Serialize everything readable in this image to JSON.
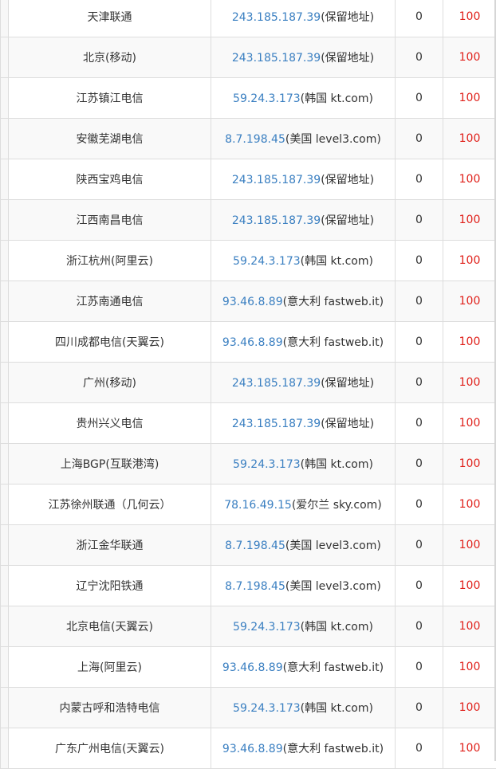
{
  "rows": [
    {
      "node": "天津联通",
      "ip": "243.185.187.39",
      "location": "(保留地址)",
      "loss": "0",
      "value": "100"
    },
    {
      "node": "北京(移动)",
      "ip": "243.185.187.39",
      "location": "(保留地址)",
      "loss": "0",
      "value": "100"
    },
    {
      "node": "江苏镇江电信",
      "ip": "59.24.3.173",
      "location": "(韩国 kt.com)",
      "loss": "0",
      "value": "100"
    },
    {
      "node": "安徽芜湖电信",
      "ip": "8.7.198.45",
      "location": "(美国 level3.com)",
      "loss": "0",
      "value": "100"
    },
    {
      "node": "陕西宝鸡电信",
      "ip": "243.185.187.39",
      "location": "(保留地址)",
      "loss": "0",
      "value": "100"
    },
    {
      "node": "江西南昌电信",
      "ip": "243.185.187.39",
      "location": "(保留地址)",
      "loss": "0",
      "value": "100"
    },
    {
      "node": "浙江杭州(阿里云)",
      "ip": "59.24.3.173",
      "location": "(韩国 kt.com)",
      "loss": "0",
      "value": "100"
    },
    {
      "node": "江苏南通电信",
      "ip": "93.46.8.89",
      "location": "(意大利 fastweb.it)",
      "loss": "0",
      "value": "100"
    },
    {
      "node": "四川成都电信(天翼云)",
      "ip": "93.46.8.89",
      "location": "(意大利 fastweb.it)",
      "loss": "0",
      "value": "100"
    },
    {
      "node": "广州(移动)",
      "ip": "243.185.187.39",
      "location": "(保留地址)",
      "loss": "0",
      "value": "100"
    },
    {
      "node": "贵州兴义电信",
      "ip": "243.185.187.39",
      "location": "(保留地址)",
      "loss": "0",
      "value": "100"
    },
    {
      "node": "上海BGP(互联港湾)",
      "ip": "59.24.3.173",
      "location": "(韩国 kt.com)",
      "loss": "0",
      "value": "100"
    },
    {
      "node": "江苏徐州联通（几何云）",
      "ip": "78.16.49.15",
      "location": "(爱尔兰 sky.com)",
      "loss": "0",
      "value": "100"
    },
    {
      "node": "浙江金华联通",
      "ip": "8.7.198.45",
      "location": "(美国 level3.com)",
      "loss": "0",
      "value": "100"
    },
    {
      "node": "辽宁沈阳铁通",
      "ip": "8.7.198.45",
      "location": "(美国 level3.com)",
      "loss": "0",
      "value": "100"
    },
    {
      "node": "北京电信(天翼云)",
      "ip": "59.24.3.173",
      "location": "(韩国 kt.com)",
      "loss": "0",
      "value": "100"
    },
    {
      "node": "上海(阿里云)",
      "ip": "93.46.8.89",
      "location": "(意大利 fastweb.it)",
      "loss": "0",
      "value": "100"
    },
    {
      "node": "内蒙古呼和浩特电信",
      "ip": "59.24.3.173",
      "location": "(韩国 kt.com)",
      "loss": "0",
      "value": "100"
    },
    {
      "node": "广东广州电信(天翼云)",
      "ip": "93.46.8.89",
      "location": "(意大利 fastweb.it)",
      "loss": "0",
      "value": "100"
    }
  ],
  "colors": {
    "ip_link": "#3a7fc1",
    "value_red": "#e0201a",
    "border": "#dddddd"
  }
}
